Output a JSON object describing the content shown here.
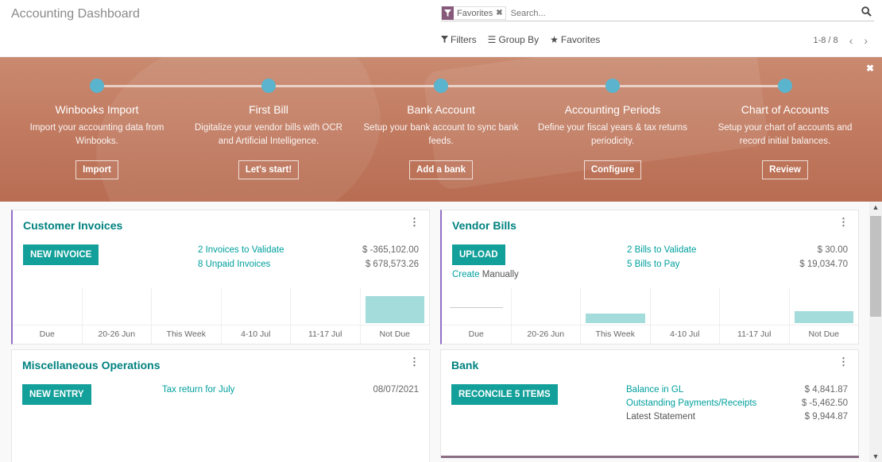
{
  "header": {
    "title": "Accounting Dashboard",
    "search": {
      "facet_icon": "filter-icon",
      "facet_value": "Favorites",
      "placeholder": "Search..."
    },
    "filters_label": "Filters",
    "group_by_label": "Group By",
    "favorites_label": "Favorites",
    "pager": "1-8 / 8"
  },
  "banner": {
    "steps": [
      {
        "title": "Winbooks Import",
        "desc": "Import your accounting data from Winbooks.",
        "button": "Import"
      },
      {
        "title": "First Bill",
        "desc": "Digitalize your vendor bills with OCR and Artificial Intelligence.",
        "button": "Let's start!"
      },
      {
        "title": "Bank Account",
        "desc": "Setup your bank account to sync bank feeds.",
        "button": "Add a bank"
      },
      {
        "title": "Accounting Periods",
        "desc": "Define your fiscal years & tax returns periodicity.",
        "button": "Configure"
      },
      {
        "title": "Chart of Accounts",
        "desc": "Setup your chart of accounts and record initial balances.",
        "button": "Review"
      }
    ]
  },
  "cards": {
    "customer_invoices": {
      "title": "Customer Invoices",
      "button": "NEW INVOICE",
      "stats": [
        {
          "label": "2 Invoices to Validate",
          "value": "$ -365,102.00"
        },
        {
          "label": "8 Unpaid Invoices",
          "value": "$ 678,573.26"
        }
      ],
      "graph": {
        "categories": [
          "Due",
          "20-26 Jun",
          "This Week",
          "4-10 Jul",
          "11-17 Jul",
          "Not Due"
        ],
        "values": [
          0,
          0,
          0,
          0,
          0,
          1.0
        ]
      }
    },
    "vendor_bills": {
      "title": "Vendor Bills",
      "button": "UPLOAD",
      "create_link": "Create",
      "create_text": "Manually",
      "stats": [
        {
          "label": "2 Bills to Validate",
          "value": "$ 30.00"
        },
        {
          "label": "5 Bills to Pay",
          "value": "$ 19,034.70"
        }
      ],
      "graph": {
        "categories": [
          "Due",
          "20-26 Jun",
          "This Week",
          "4-10 Jul",
          "11-17 Jul",
          "Not Due"
        ],
        "values": [
          0,
          0,
          0.35,
          0,
          0,
          0.45
        ]
      }
    },
    "misc_operations": {
      "title": "Miscellaneous Operations",
      "button": "NEW ENTRY",
      "item_label": "Tax return for July",
      "item_date": "08/07/2021"
    },
    "bank": {
      "title": "Bank",
      "button": "RECONCILE 5 ITEMS",
      "stats": [
        {
          "label": "Balance in GL",
          "value": "$ 4,841.87",
          "link": true
        },
        {
          "label": "Outstanding Payments/Receipts",
          "value": "$ -5,462.50",
          "link": true
        },
        {
          "label": "Latest Statement",
          "value": "$ 9,944.87",
          "link": false
        }
      ]
    }
  },
  "colors": {
    "brand": "#875a7b",
    "teal": "#14a09a",
    "teal_text": "#00827f",
    "bar": "#a3dcdb",
    "banner": "#c27c62",
    "step_dot": "#5ab4cd"
  }
}
